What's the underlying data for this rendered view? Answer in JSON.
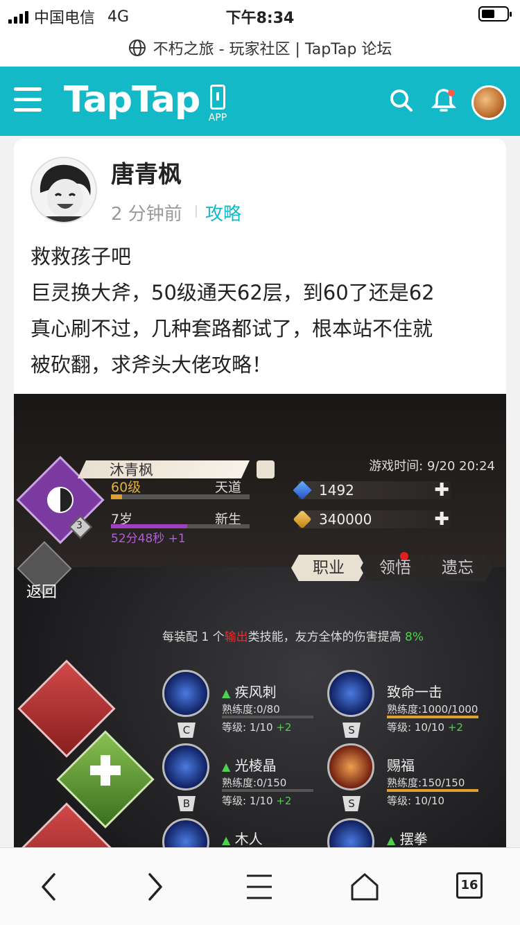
{
  "status": {
    "carrier": "中国电信",
    "network": "4G",
    "time": "下午8:34"
  },
  "url": {
    "title": "不朽之旅 - 玩家社区 | TapTap 论坛"
  },
  "nav": {
    "logo": "TapTap",
    "app_label": "APP"
  },
  "post": {
    "author": "唐青枫",
    "time": "2 分钟前",
    "tag": "攻略",
    "lines": [
      "救救孩子吧",
      "巨灵换大斧，50级通天62层，到60了还是62",
      "真心刷不过，几种套路都试了，根本站不住就",
      "被砍翻，求斧头大佬攻略！"
    ]
  },
  "game": {
    "char_name": "沐青枫",
    "level": "60级",
    "realm": "天道",
    "age": "7岁",
    "stage": "新生",
    "timer": "52分48秒 +1",
    "time_label": "游戏时间: 9/20 20:24",
    "gems": "1492",
    "coins": "340000",
    "badge_level": "3",
    "back": "返回",
    "tabs": [
      "职业",
      "领悟",
      "遗忘"
    ],
    "tip_prefix": "每装配 1 个",
    "tip_highlight": "输出",
    "tip_middle": "类技能，友方全体的伤害提高",
    "tip_pct": "8%",
    "skills": [
      {
        "name": "疾风刺",
        "prof": "熟练度:0/80",
        "lvl": "等级: 1/10",
        "plus": "+2",
        "rank": "C",
        "progress": 0
      },
      {
        "name": "致命一击",
        "prof": "熟练度:1000/1000",
        "lvl": "等级: 10/10",
        "plus": "+2",
        "rank": "S",
        "progress": 1
      },
      {
        "name": "光棱晶",
        "prof": "熟练度:0/150",
        "lvl": "等级: 1/10",
        "plus": "+2",
        "rank": "B",
        "progress": 0
      },
      {
        "name": "赐福",
        "prof": "熟练度:150/150",
        "lvl": "等级: 10/10",
        "plus": "",
        "rank": "S",
        "progress": 1
      },
      {
        "name": "木人",
        "prof": "",
        "lvl": "",
        "plus": "",
        "rank": "",
        "progress": 0
      },
      {
        "name": "摆拳",
        "prof": "",
        "lvl": "",
        "plus": "",
        "rank": "",
        "progress": 0
      }
    ]
  },
  "browser": {
    "tab_count": "16"
  },
  "colors": {
    "accent": "#14b9c8"
  }
}
